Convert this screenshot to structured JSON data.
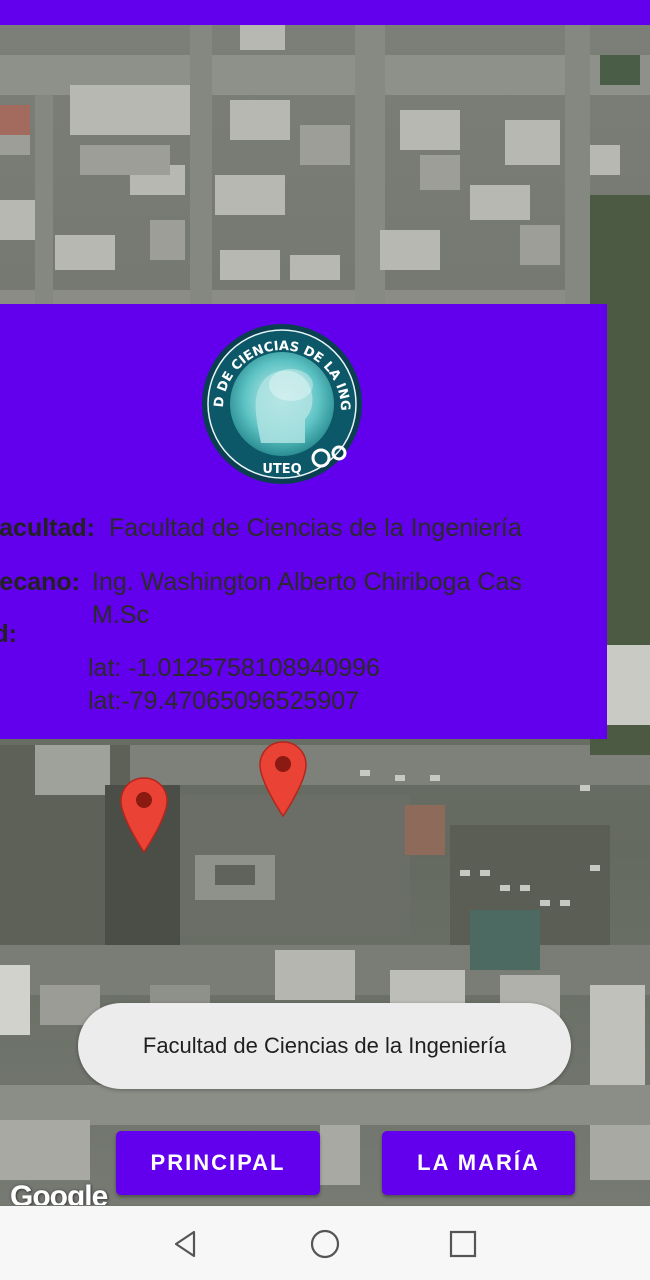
{
  "map": {
    "attribution": "Google",
    "markers": [
      {
        "name": "marker-1"
      },
      {
        "name": "marker-2"
      }
    ]
  },
  "info_window": {
    "logo_text": "FACULTAD DE CIENCIAS DE LA INGENIERÍA",
    "logo_org": "UTEQ",
    "facultad_label": "Facultad:",
    "facultad_value": "Facultad de Ciencias de la Ingeniería",
    "decano_label": "Decano:",
    "decano_value_line1": "Ing. Washington Alberto Chiriboga Cas",
    "decano_value_line2": "M.Sc",
    "coord_label": "Coord:",
    "lat_line": "lat: -1.0125758108940996",
    "lng_line": "lat:-79.47065096525907"
  },
  "toast": {
    "message": "Facultad de Ciencias de la Ingeniería"
  },
  "buttons": {
    "principal": "PRINCIPAL",
    "la_maria": "LA MARÍA"
  },
  "colors": {
    "primary": "#6200ee",
    "marker": "#ea4335",
    "toast_bg": "#ececec",
    "nav_bg": "#f7f7f7"
  },
  "nav": {
    "back": "back-icon",
    "home": "home-icon",
    "recents": "recents-icon"
  }
}
